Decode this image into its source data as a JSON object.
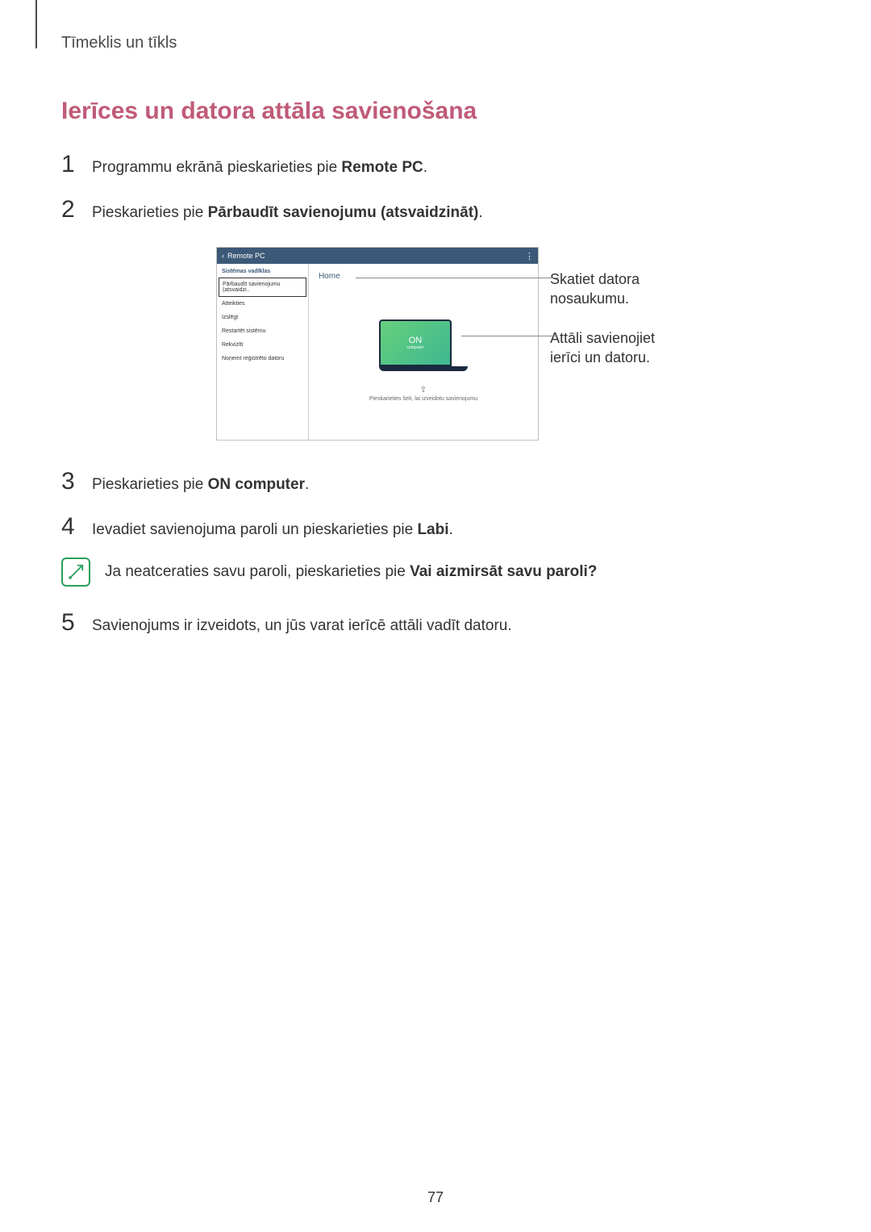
{
  "breadcrumb": "Tīmeklis un tīkls",
  "heading": "Ierīces un datora attāla savienošana",
  "steps": {
    "s1_pre": "Programmu ekrānā pieskarieties pie ",
    "s1_bold": "Remote PC",
    "s1_post": ".",
    "s2_pre": "Pieskarieties pie ",
    "s2_bold": "Pārbaudīt savienojumu (atsvaidzināt)",
    "s2_post": ".",
    "s3_pre": "Pieskarieties pie ",
    "s3_bold": "ON computer",
    "s3_post": ".",
    "s4_pre": "Ievadiet savienojuma paroli un pieskarieties pie ",
    "s4_bold": "Labi",
    "s4_post": ".",
    "s5": "Savienojums ir izveidots, un jūs varat ierīcē attāli vadīt datoru."
  },
  "note_pre": "Ja neatceraties savu paroli, pieskarieties pie ",
  "note_bold": "Vai aizmirsāt savu paroli?",
  "screenshot": {
    "title": "Remote PC",
    "sidebar_head": "Sistēmas vadīklas",
    "sidebar_items": [
      "Pārbaudīt savienojumu (atsvaidzi..",
      "Atteikties",
      "Izslēgt",
      "Restartēt sistēmu",
      "Rekvizīti",
      "Noņemt reģistrēto datoru"
    ],
    "home_label": "Home",
    "on": "ON",
    "on_sub": "computer",
    "tap_hint": "Pieskarieties šeit, lai izveidotu savienojumu"
  },
  "callouts": {
    "see_name_l1": "Skatiet datora",
    "see_name_l2": "nosaukumu.",
    "remote_l1": "Attāli savienojiet",
    "remote_l2": "ierīci un datoru."
  },
  "page_number": "77"
}
